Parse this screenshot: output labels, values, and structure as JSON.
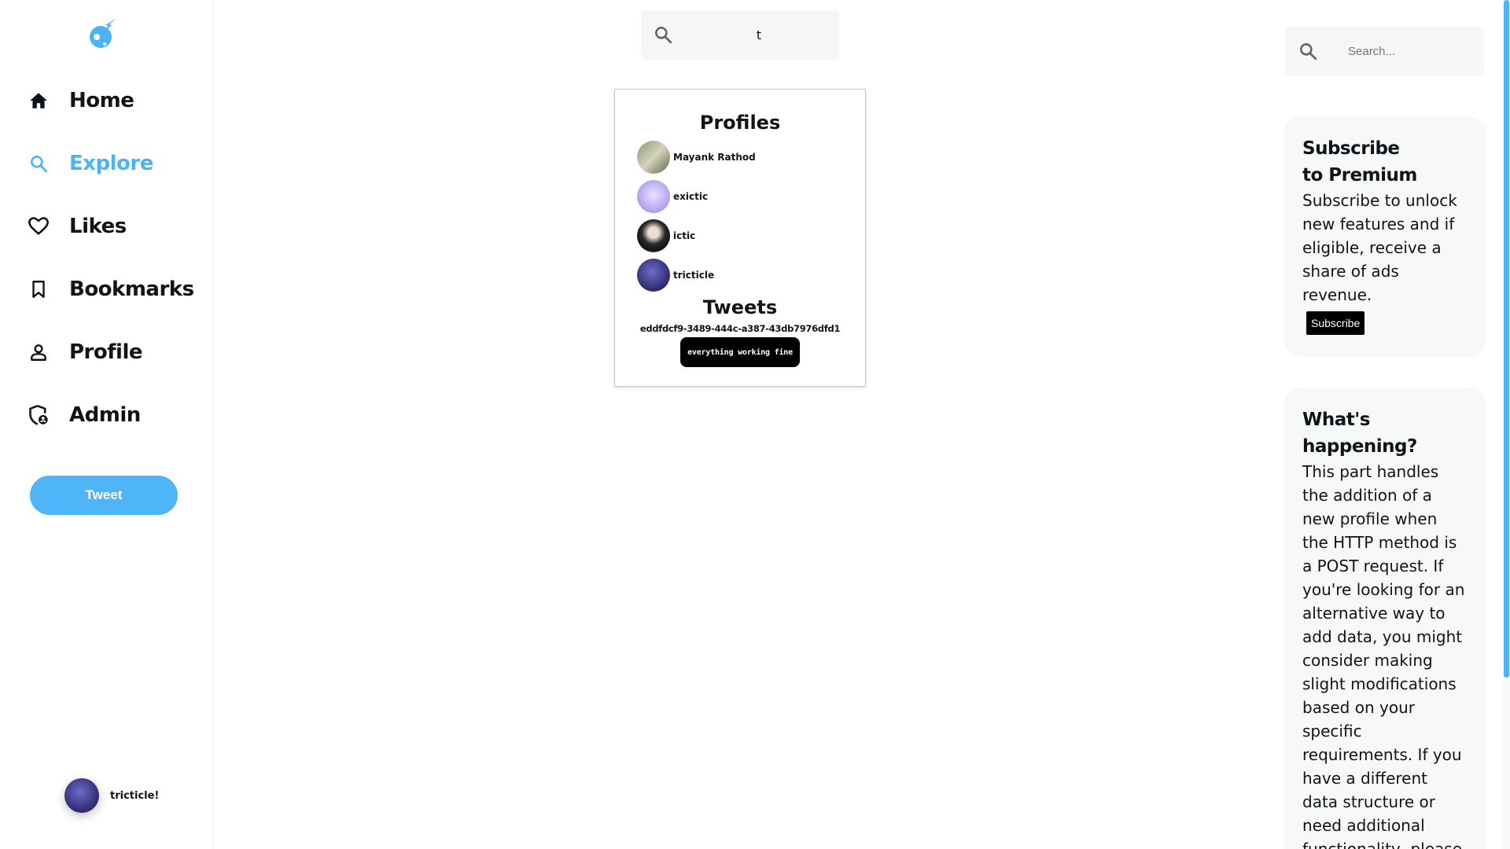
{
  "nav": {
    "items": [
      {
        "label": "Home",
        "icon": "home-icon"
      },
      {
        "label": "Explore",
        "icon": "search-icon"
      },
      {
        "label": "Likes",
        "icon": "heart-icon"
      },
      {
        "label": "Bookmarks",
        "icon": "bookmark-icon"
      },
      {
        "label": "Profile",
        "icon": "person-icon"
      },
      {
        "label": "Admin",
        "icon": "shield-admin-icon"
      }
    ],
    "active": "Explore",
    "tweet_button": "Tweet"
  },
  "user": {
    "name": "tricticle!"
  },
  "search": {
    "value": "t"
  },
  "results": {
    "profiles_title": "Profiles",
    "profiles": [
      {
        "name": "Mayank Rathod"
      },
      {
        "name": "exictic"
      },
      {
        "name": "ictic"
      },
      {
        "name": "tricticle"
      }
    ],
    "tweets_title": "Tweets",
    "tweet_id": "eddfdcf9-3489-444c-a387-43db7976dfd1",
    "tweet_text": "everything working fine"
  },
  "right": {
    "search_placeholder": "Search...",
    "premium": {
      "title_line1": "Subscribe",
      "title_line2": "to Premium",
      "body": "Subscribe to unlock new features and if eligible, receive a share of ads revenue.",
      "button": "Subscribe"
    },
    "happening": {
      "title_line1": "What's",
      "title_line2": "happening?",
      "body": "This part handles the addition of a new profile when the HTTP method is a POST request. If you're looking for an alternative way to add data, you might consider making slight modifications based on your specific requirements. If you have a different data structure or need additional functionality, please"
    }
  },
  "colors": {
    "accent": "#4bb4f7",
    "tweet_button": "#4db5f8"
  }
}
